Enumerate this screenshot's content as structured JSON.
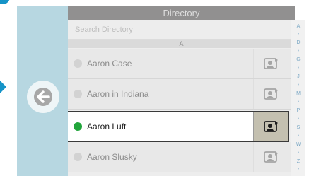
{
  "directory": {
    "title": "Directory",
    "search_placeholder": "Search Directory",
    "section_letter": "A",
    "contacts": [
      {
        "name": "Aaron Case",
        "status": "offline",
        "selected": false
      },
      {
        "name": "Aaron in Indiana",
        "status": "offline",
        "selected": false
      },
      {
        "name": "Aaron Luft",
        "status": "online",
        "selected": true
      },
      {
        "name": "Aaron Slusky",
        "status": "offline",
        "selected": false
      }
    ],
    "alpha_index": [
      "A",
      "•",
      "D",
      "•",
      "G",
      "•",
      "J",
      "•",
      "M",
      "•",
      "P",
      "•",
      "S",
      "•",
      "W",
      "•",
      "Z",
      "•"
    ]
  },
  "colors": {
    "online": "#21a53b",
    "offline": "#d2d2d2",
    "accent": "#1694c8"
  },
  "icons": {
    "back": "left-arrow-icon",
    "contact": "contact-card-icon"
  }
}
